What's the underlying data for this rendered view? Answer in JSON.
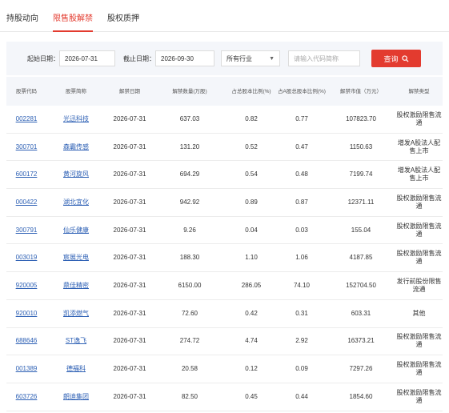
{
  "tabs": [
    "持股动向",
    "限售股解禁",
    "股权质押"
  ],
  "active_tab": 1,
  "filter": {
    "start_label": "起始日期：",
    "start_value": "2026-07-31",
    "end_label": "截止日期：",
    "end_value": "2026-09-30",
    "industry_value": "所有行业",
    "search_placeholder": "请输入代码简称",
    "query_label": "查询"
  },
  "colors": {
    "accent": "#e33b2f",
    "link": "#2c5fb4",
    "header_bg": "#f4f6fa"
  },
  "table": {
    "headers": [
      "股票代码",
      "股票简称",
      "解禁日期",
      "解禁数量(万股)",
      "占总股本比例(%)",
      "占A股总股本比例(%)",
      "解禁市值（万元）",
      "解禁类型"
    ],
    "rows": [
      [
        "002281",
        "光迅科技",
        "2026-07-31",
        "637.03",
        "0.82",
        "0.77",
        "107823.70",
        "股权激励限售流通"
      ],
      [
        "300701",
        "森霸传感",
        "2026-07-31",
        "131.20",
        "0.52",
        "0.47",
        "1150.63",
        "增发A股法人配售上市"
      ],
      [
        "600172",
        "黄河旋风",
        "2026-07-31",
        "694.29",
        "0.54",
        "0.48",
        "7199.74",
        "增发A股法人配售上市"
      ],
      [
        "000422",
        "湖北宜化",
        "2026-07-31",
        "942.92",
        "0.89",
        "0.87",
        "12371.11",
        "股权激励限售流通"
      ],
      [
        "300791",
        "仙乐健康",
        "2026-07-31",
        "9.26",
        "0.04",
        "0.03",
        "155.04",
        "股权激励限售流通"
      ],
      [
        "003019",
        "宸展光电",
        "2026-07-31",
        "188.30",
        "1.10",
        "1.06",
        "4187.85",
        "股权激励限售流通"
      ],
      [
        "920005",
        "鼎佳精密",
        "2026-07-31",
        "6150.00",
        "286.05",
        "74.10",
        "152704.50",
        "发行前股份限售流通"
      ],
      [
        "920010",
        "凯添燃气",
        "2026-07-31",
        "72.60",
        "0.42",
        "0.31",
        "603.31",
        "其他"
      ],
      [
        "688646",
        "ST逸飞",
        "2026-07-31",
        "274.72",
        "4.74",
        "2.92",
        "16373.21",
        "股权激励限售流通"
      ],
      [
        "001389",
        "德福科",
        "2026-07-31",
        "20.58",
        "0.12",
        "0.09",
        "7297.26",
        "股权激励限售流通"
      ],
      [
        "603726",
        "朗迪集团",
        "2026-07-31",
        "82.50",
        "0.45",
        "0.44",
        "1854.60",
        "股权激励限售流通"
      ]
    ]
  }
}
